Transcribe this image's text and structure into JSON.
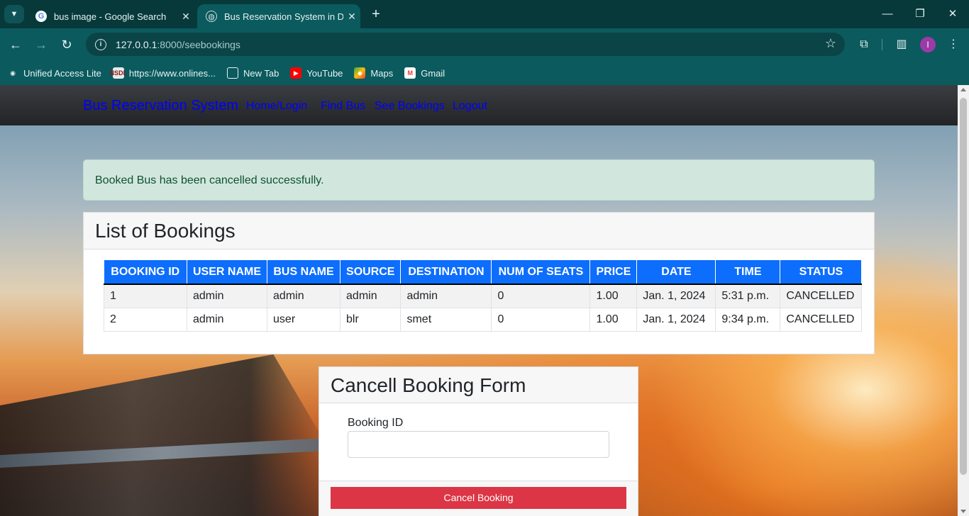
{
  "browser": {
    "tabs": [
      {
        "title": "bus image - Google Search",
        "favicon": "google-icon",
        "active": false
      },
      {
        "title": "Bus Reservation System in Djang",
        "favicon": "globe-icon",
        "active": true
      }
    ],
    "url_host": "127.0.0.1",
    "url_path": ":8000/seebookings",
    "avatar_initial": "I",
    "bookmarks": [
      {
        "label": "Unified Access Lite",
        "icon": "ual-icon"
      },
      {
        "label": "https://www.onlines...",
        "icon": "nsdl-icon"
      },
      {
        "label": "New Tab",
        "icon": "globe-icon"
      },
      {
        "label": "YouTube",
        "icon": "youtube-icon"
      },
      {
        "label": "Maps",
        "icon": "maps-icon"
      },
      {
        "label": "Gmail",
        "icon": "gmail-icon"
      }
    ]
  },
  "nav": {
    "brand": "Bus Reservation System",
    "links": [
      "Home/Login",
      "Find Bus",
      "See Bookings",
      "Logout"
    ]
  },
  "alert": {
    "message": "Booked Bus has been cancelled successfully."
  },
  "bookings": {
    "title": "List of Bookings",
    "columns": [
      "BOOKING ID",
      "USER NAME",
      "BUS NAME",
      "SOURCE",
      "DESTINATION",
      "NUM OF SEATS",
      "PRICE",
      "DATE",
      "TIME",
      "STATUS"
    ],
    "rows": [
      [
        "1",
        "admin",
        "admin",
        "admin",
        "admin",
        "0",
        "1.00",
        "Jan. 1, 2024",
        "5:31 p.m.",
        "CANCELLED"
      ],
      [
        "2",
        "admin",
        "user",
        "blr",
        "smet",
        "0",
        "1.00",
        "Jan. 1, 2024",
        "9:34 p.m.",
        "CANCELLED"
      ]
    ]
  },
  "cancel_form": {
    "title": "Cancell Booking Form",
    "label": "Booking ID",
    "value": "",
    "button": "Cancel Booking"
  },
  "colors": {
    "table_header": "#0d6efd",
    "alert_bg": "#d1e7dd",
    "cancel_button": "#dc3545",
    "nav_link": "#0000ff"
  }
}
